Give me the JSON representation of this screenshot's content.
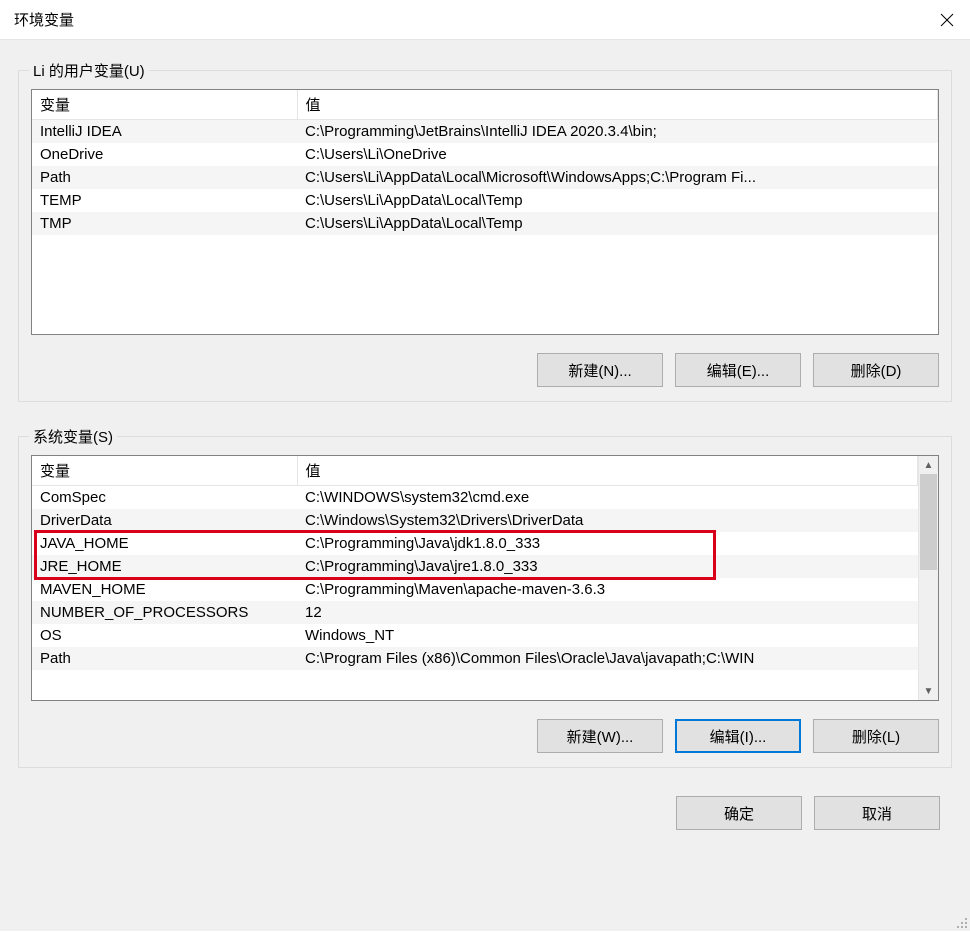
{
  "window": {
    "title": "环境变量"
  },
  "user_section": {
    "label": "Li 的用户变量(U)",
    "columns": {
      "name": "变量",
      "value": "值"
    },
    "rows": [
      {
        "name": "IntelliJ IDEA",
        "value": "C:\\Programming\\JetBrains\\IntelliJ IDEA 2020.3.4\\bin;"
      },
      {
        "name": "OneDrive",
        "value": "C:\\Users\\Li\\OneDrive"
      },
      {
        "name": "Path",
        "value": "C:\\Users\\Li\\AppData\\Local\\Microsoft\\WindowsApps;C:\\Program Fi..."
      },
      {
        "name": "TEMP",
        "value": "C:\\Users\\Li\\AppData\\Local\\Temp"
      },
      {
        "name": "TMP",
        "value": "C:\\Users\\Li\\AppData\\Local\\Temp"
      }
    ],
    "buttons": {
      "new": "新建(N)...",
      "edit": "编辑(E)...",
      "delete": "删除(D)"
    }
  },
  "system_section": {
    "label": "系统变量(S)",
    "columns": {
      "name": "变量",
      "value": "值"
    },
    "rows": [
      {
        "name": "ComSpec",
        "value": "C:\\WINDOWS\\system32\\cmd.exe"
      },
      {
        "name": "DriverData",
        "value": "C:\\Windows\\System32\\Drivers\\DriverData"
      },
      {
        "name": "JAVA_HOME",
        "value": "C:\\Programming\\Java\\jdk1.8.0_333"
      },
      {
        "name": "JRE_HOME",
        "value": "C:\\Programming\\Java\\jre1.8.0_333"
      },
      {
        "name": "MAVEN_HOME",
        "value": "C:\\Programming\\Maven\\apache-maven-3.6.3"
      },
      {
        "name": "NUMBER_OF_PROCESSORS",
        "value": "12"
      },
      {
        "name": "OS",
        "value": "Windows_NT"
      },
      {
        "name": "Path",
        "value": "C:\\Program Files (x86)\\Common Files\\Oracle\\Java\\javapath;C:\\WIN"
      }
    ],
    "buttons": {
      "new": "新建(W)...",
      "edit": "编辑(I)...",
      "delete": "删除(L)"
    }
  },
  "footer": {
    "ok": "确定",
    "cancel": "取消"
  },
  "highlight": {
    "rows": [
      2,
      3
    ]
  }
}
